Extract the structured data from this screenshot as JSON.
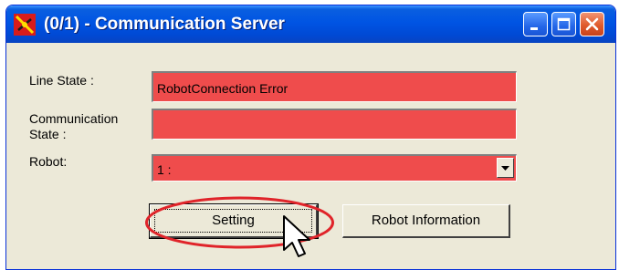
{
  "window": {
    "title": "(0/1) - Communication Server",
    "controls": {
      "minimize": "minimize-icon",
      "maximize": "maximize-icon",
      "close": "close-icon"
    }
  },
  "fields": {
    "line_state": {
      "label": "Line State :",
      "value": "RobotConnection Error"
    },
    "communication_state": {
      "label_line1": "Communication",
      "label_line2": "State :",
      "value": ""
    },
    "robot": {
      "label": "Robot:",
      "value": "1 :"
    }
  },
  "buttons": {
    "setting": "Setting",
    "robot_information": "Robot Information"
  },
  "colors": {
    "field_error": "#ef4c4c",
    "annotation": "#e0242a",
    "title_bar": "#0054e3"
  },
  "icons": [
    "app-icon",
    "minimize-icon",
    "maximize-icon",
    "close-icon",
    "dropdown-arrow-icon",
    "mouse-cursor-icon"
  ]
}
